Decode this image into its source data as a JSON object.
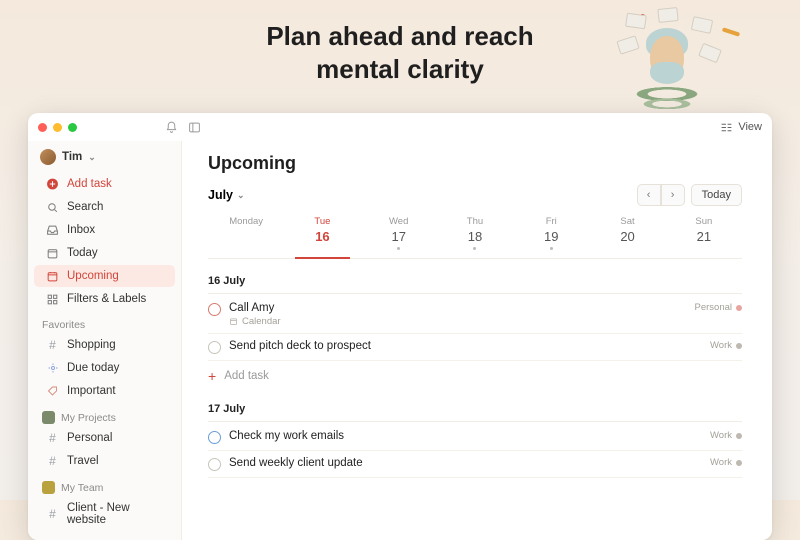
{
  "hero": {
    "line1": "Plan ahead and reach",
    "line2": "mental clarity"
  },
  "titlebar": {
    "view": "View"
  },
  "user": {
    "name": "Tim"
  },
  "sidebar": {
    "add_task": "Add task",
    "search": "Search",
    "inbox": "Inbox",
    "today": "Today",
    "upcoming": "Upcoming",
    "filters": "Filters & Labels",
    "favorites_h": "Favorites",
    "fav": {
      "shopping": "Shopping",
      "due_today": "Due today",
      "important": "Important"
    },
    "my_projects_h": "My Projects",
    "proj": {
      "personal": "Personal",
      "travel": "Travel"
    },
    "my_team_h": "My Team",
    "team": {
      "client": "Client - New website"
    }
  },
  "main": {
    "title": "Upcoming",
    "month": "July",
    "today": "Today",
    "days": [
      {
        "name": "Monday",
        "num": ""
      },
      {
        "name": "Tue",
        "num": "16"
      },
      {
        "name": "Wed",
        "num": "17"
      },
      {
        "name": "Thu",
        "num": "18"
      },
      {
        "name": "Fri",
        "num": "19"
      },
      {
        "name": "Sat",
        "num": "20"
      },
      {
        "name": "Sun",
        "num": "21"
      }
    ],
    "sec1": "16 July",
    "sec2": "17 July",
    "add_task": "Add task",
    "tasks1": [
      {
        "title": "Call Amy",
        "meta": "Calendar",
        "proj": "Personal",
        "dot": "pink"
      },
      {
        "title": "Send pitch deck to prospect",
        "meta": "",
        "proj": "Work",
        "dot": "gray"
      }
    ],
    "tasks2": [
      {
        "title": "Check my work emails",
        "meta": "",
        "proj": "Work",
        "dot": "gray"
      },
      {
        "title": "Send weekly client update",
        "meta": "",
        "proj": "Work",
        "dot": "gray"
      }
    ]
  }
}
